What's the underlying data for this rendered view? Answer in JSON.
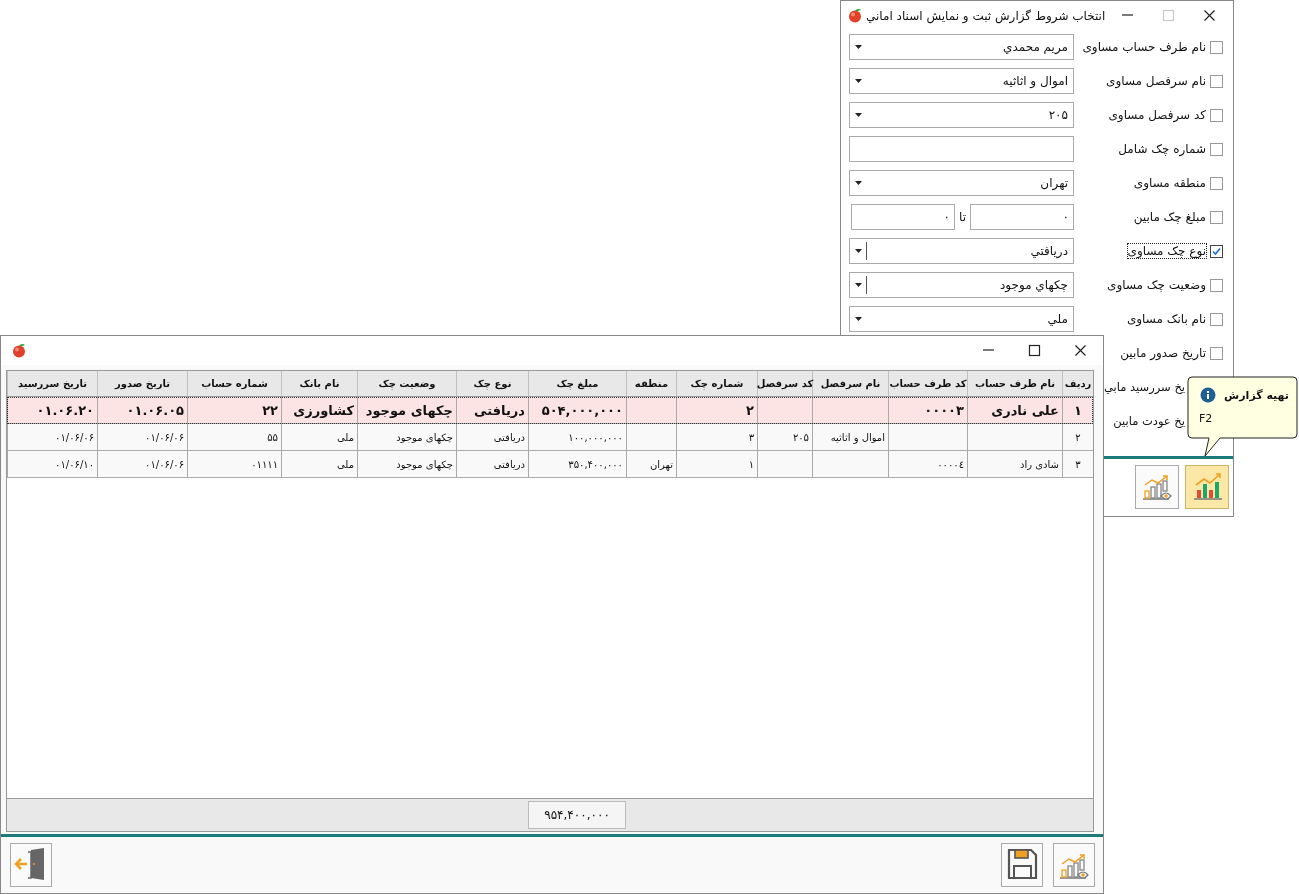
{
  "filter_window": {
    "title": "انتخاب شروط گزارش ثبت و نمايش اسناد اماني",
    "rows": [
      {
        "label": "نام طرف حساب مساوی",
        "checked": false,
        "focused": false,
        "kind": "combo",
        "value": "مريم محمدي"
      },
      {
        "label": "نام سرفصل مساوی",
        "checked": false,
        "focused": false,
        "kind": "combo",
        "value": "اموال و اثاثيه"
      },
      {
        "label": "کد سرفصل مساوی",
        "checked": false,
        "focused": false,
        "kind": "combo",
        "value": "۲۰۵"
      },
      {
        "label": "شماره چک شامل",
        "checked": false,
        "focused": false,
        "kind": "text"
      },
      {
        "label": "منطقه مساوی",
        "checked": false,
        "focused": false,
        "kind": "combo",
        "value": "تهران"
      },
      {
        "label": "مبلغ چک مابین",
        "checked": false,
        "focused": false,
        "kind": "range",
        "from": "۰",
        "separator": "تا",
        "to": "۰"
      },
      {
        "label": "نوع چک مساوی",
        "checked": true,
        "focused": true,
        "kind": "combo-split",
        "value": "دريافتي"
      },
      {
        "label": "وضعیت چک مساوی",
        "checked": false,
        "focused": false,
        "kind": "combo-split",
        "value": "چکهاي موجود"
      },
      {
        "label": "نام بانک مساوی",
        "checked": false,
        "focused": false,
        "kind": "combo",
        "value": "ملي"
      },
      {
        "label": "تاریخ صدور مابین",
        "checked": false,
        "focused": false,
        "kind": "hidden"
      },
      {
        "label": "يخ سررسيد مابي",
        "covered": true,
        "focused": false,
        "kind": "hidden"
      },
      {
        "label": "يخ عودت مابين",
        "covered": true,
        "focused": false,
        "kind": "hidden"
      }
    ],
    "tooltip": {
      "title": "تهیه گزارش",
      "shortcut": "F2"
    }
  },
  "report_window": {
    "columns": [
      "ردیف",
      "نام طرف حساب",
      "کد طرف حساب",
      "نام سرفصل",
      "کد سرفصل",
      "شماره چک",
      "منطقه",
      "مبلغ چک",
      "نوع چک",
      "وضعیت چک",
      "نام بانک",
      "شماره حساب",
      "تاریخ صدور",
      "تاریخ سررسید"
    ],
    "rows": [
      {
        "selected": true,
        "cells": [
          "۱",
          "علی نادری",
          "۰۰۰۰۳",
          null,
          null,
          "۲",
          null,
          "۵۰۴,۰۰۰,۰۰۰",
          "دریافتی",
          "چکهای موجود",
          "کشاورزی",
          "۲۲",
          "۰۱.۰۶.۰۵",
          "۰۱.۰۶.۲۰"
        ]
      },
      {
        "selected": false,
        "cells": [
          "۲",
          null,
          null,
          "اموال و اثاثیه",
          "۲۰۵",
          "۳",
          null,
          "۱۰۰,۰۰۰,۰۰۰",
          "دریافتی",
          "چکهای موجود",
          "ملی",
          "۵۵",
          "۰۱/۰۶/۰۶",
          "۰۱/۰۶/۰۶"
        ]
      },
      {
        "selected": false,
        "cells": [
          "۳",
          "شادی راد",
          "۰۰۰۰٤",
          null,
          null,
          "۱",
          "تهران",
          "۳۵۰,۴۰۰,۰۰۰",
          "دریافتی",
          "چکهای موجود",
          "ملی",
          "۰۱۱۱۱",
          "۰۱/۰۶/۰۶",
          "۰۱/۰۶/۱۰"
        ]
      }
    ],
    "total": "۹۵۴,۴۰۰,۰۰۰"
  }
}
